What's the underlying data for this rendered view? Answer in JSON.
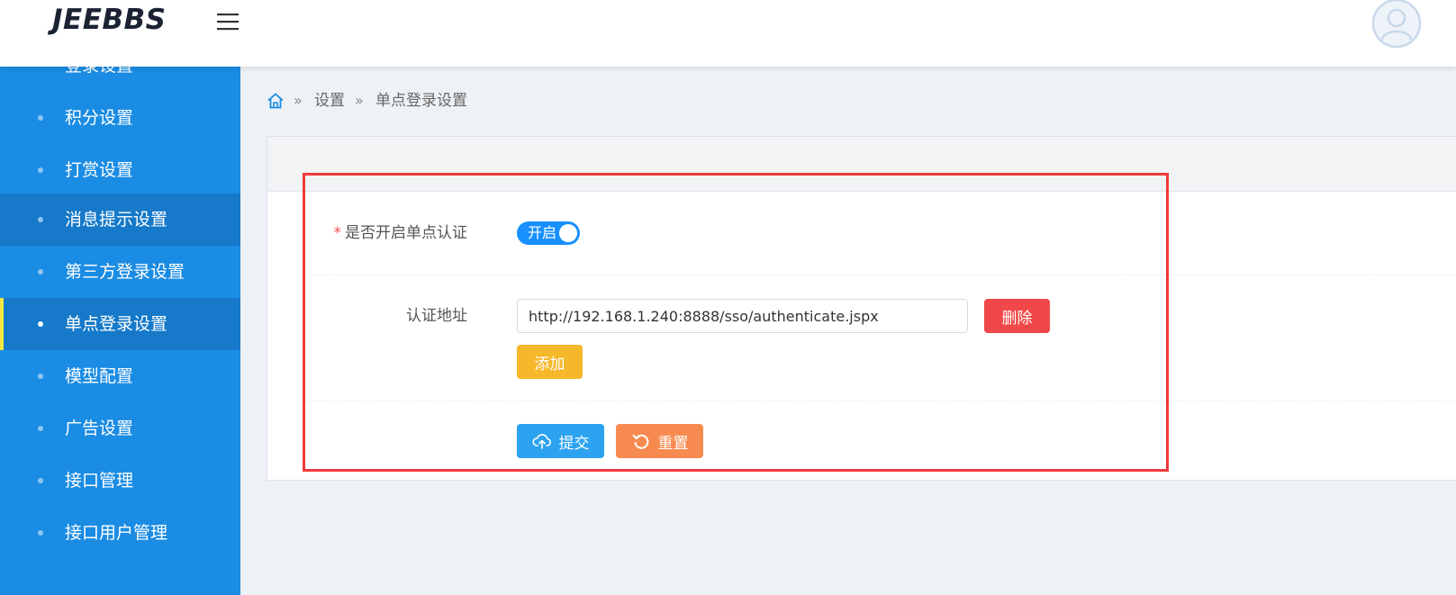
{
  "header": {
    "logo_text": "JEEBBS",
    "menu_icon": "hamburger-menu-icon",
    "avatar_icon": "user-avatar-icon"
  },
  "sidebar": {
    "partial_top_label": "登录设置",
    "items": [
      {
        "label": "积分设置",
        "state": "normal"
      },
      {
        "label": "打赏设置",
        "state": "normal"
      },
      {
        "label": "消息提示设置",
        "state": "hover"
      },
      {
        "label": "第三方登录设置",
        "state": "normal"
      },
      {
        "label": "单点登录设置",
        "state": "active"
      },
      {
        "label": "模型配置",
        "state": "normal"
      },
      {
        "label": "广告设置",
        "state": "normal"
      },
      {
        "label": "接口管理",
        "state": "normal"
      },
      {
        "label": "接口用户管理",
        "state": "normal"
      }
    ]
  },
  "breadcrumb": {
    "home_icon": "home-icon",
    "separator": "»",
    "items": [
      "设置",
      "单点登录设置"
    ]
  },
  "form": {
    "sso_enable": {
      "required_mark": "*",
      "label": "是否开启单点认证",
      "toggle_text": "开启",
      "enabled": true
    },
    "auth_address": {
      "label": "认证地址",
      "value": "http://192.168.1.240:8888/sso/authenticate.jspx",
      "delete_label": "删除",
      "add_label": "添加"
    },
    "actions": {
      "submit_label": "提交",
      "reset_label": "重置"
    }
  },
  "colors": {
    "sidebar_bg": "#1b8ce3",
    "sidebar_active_bg": "#1679c9",
    "active_indicator": "#f5e642",
    "toggle_on": "#1890ff",
    "delete_btn": "#f04848",
    "add_btn": "#f6b82b",
    "submit_btn": "#2ca2f0",
    "reset_btn": "#f78a4f",
    "highlight_border": "#f03a3a"
  }
}
